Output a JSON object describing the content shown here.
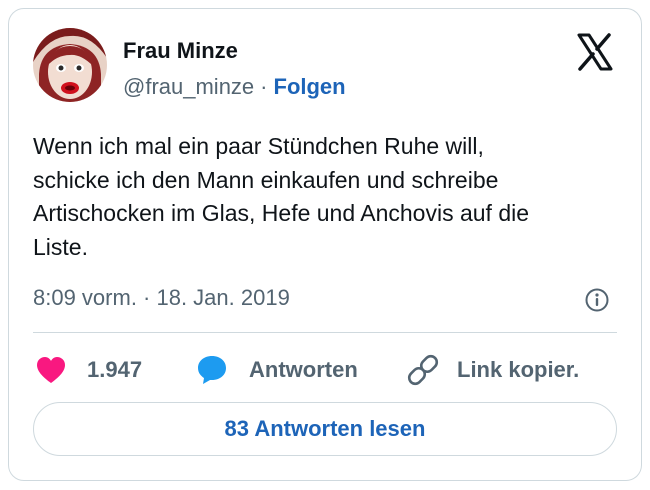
{
  "author": {
    "name": "Frau Minze",
    "handle": "@frau_minze",
    "separator": "·",
    "follow_label": "Folgen"
  },
  "platform_icon": "x-logo-icon",
  "tweet": {
    "lines": [
      "Wenn ich mal ein paar Stündchen Ruhe will,",
      "schicke ich den Mann einkaufen und schreibe",
      "Artischocken im Glas, Hefe und Anchovis auf die",
      "Liste."
    ],
    "timestamp": "8:09 vorm. · 18. Jan. 2019"
  },
  "actions": {
    "like": {
      "icon": "heart-icon",
      "count": "1.947",
      "color": "#f91880"
    },
    "reply": {
      "icon": "speech-bubble-icon",
      "label": "Antworten",
      "color": "#1d9bf0"
    },
    "copy_link": {
      "icon": "link-icon",
      "label": "Link kopier."
    }
  },
  "read_replies_label": "83 Antworten lesen",
  "colors": {
    "text_primary": "#0f1419",
    "text_secondary": "#536471",
    "link_blue": "#1d64b8",
    "border": "#cfd9de"
  }
}
